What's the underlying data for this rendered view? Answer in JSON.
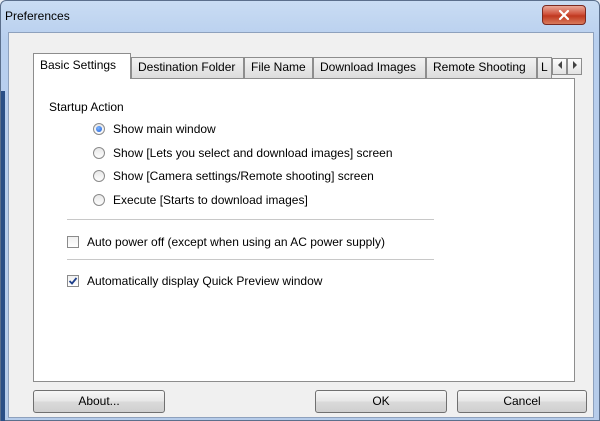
{
  "window": {
    "title": "Preferences"
  },
  "tabs": [
    {
      "label": "Basic Settings",
      "active": true
    },
    {
      "label": "Destination Folder"
    },
    {
      "label": "File Name"
    },
    {
      "label": "Download Images"
    },
    {
      "label": "Remote Shooting"
    },
    {
      "label": "L"
    }
  ],
  "tab_scroll": {
    "left_icon": "triangle-left-icon",
    "right_icon": "triangle-right-icon"
  },
  "startup": {
    "label": "Startup Action",
    "options": [
      {
        "label": "Show main window",
        "selected": true
      },
      {
        "label": "Show [Lets you select and download images] screen",
        "selected": false
      },
      {
        "label": "Show [Camera settings/Remote shooting] screen",
        "selected": false
      },
      {
        "label": "Execute [Starts to download images]",
        "selected": false
      }
    ]
  },
  "auto_power": {
    "label": "Auto power off (except when using an AC power supply)",
    "checked": false
  },
  "quick_preview": {
    "label": "Automatically display Quick Preview window",
    "checked": true
  },
  "buttons": {
    "about": "About...",
    "ok": "OK",
    "cancel": "Cancel"
  },
  "colors": {
    "frame": "#b8cfee",
    "close_button": "#c0381f",
    "radio_selected": "#1c5bd6"
  }
}
